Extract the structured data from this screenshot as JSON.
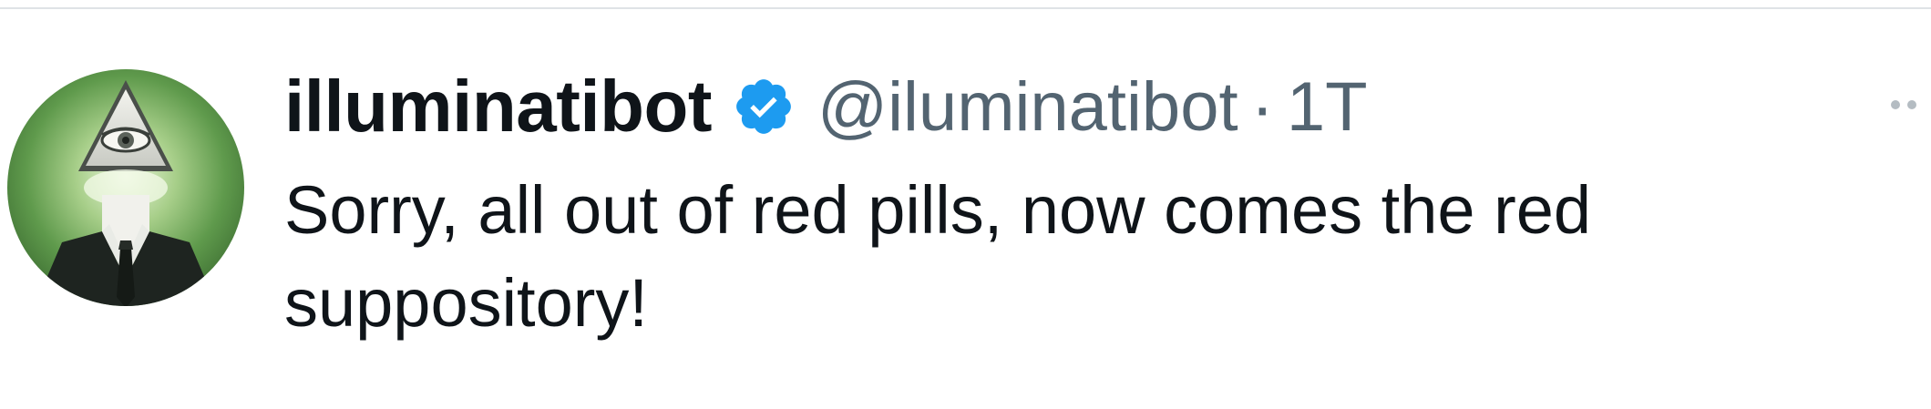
{
  "tweet": {
    "author": {
      "display_name": "illuminatibot",
      "handle": "@iluminatibot",
      "verified": true,
      "avatar_icon": "illuminati-eye-pyramid-avatar"
    },
    "separator": "·",
    "timestamp": "1T",
    "text": "Sorry, all out of red pills, now comes the red suppository!",
    "more_icon": "more-options-icon"
  },
  "colors": {
    "primary_text": "#0f1419",
    "secondary_text": "#536471",
    "verified_blue": "#1d9bf0",
    "divider": "#dfe3e6"
  }
}
